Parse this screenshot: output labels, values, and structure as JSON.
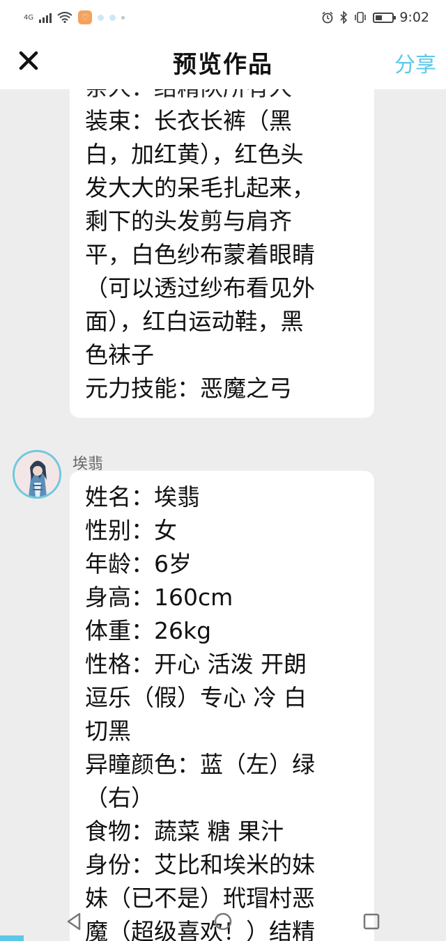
{
  "status_bar": {
    "network": "4G",
    "time": "9:02",
    "icons": [
      "signal-icon",
      "wifi-icon",
      "app-notification-icon",
      "alarm-icon",
      "bluetooth-icon",
      "vibrate-icon",
      "battery-icon"
    ]
  },
  "navbar": {
    "close_icon": "close-icon",
    "title": "预览作品",
    "share_label": "分享"
  },
  "post1": {
    "lines": [
      "亲人：结精队所有人",
      "装束：长衣长裤（黑",
      "白，加红黄），红色头",
      "发大大的呆毛扎起来，",
      "剩下的头发剪与肩齐",
      "平，白色纱布蒙着眼睛",
      "（可以透过纱布看见外",
      "面），红白运动鞋，黑",
      "色袜子",
      "元力技能：恶魔之弓"
    ]
  },
  "post2": {
    "author": "埃翡",
    "lines": [
      "姓名：埃翡",
      "性别：女",
      "年龄：6岁",
      "身高：160cm",
      "体重：26kg",
      "性格：开心 活泼 开朗",
      "逗乐（假）专心 冷 白",
      "切黑",
      "异瞳颜色：蓝（左）绿",
      "（右）",
      "食物：蔬菜 糖 果汁",
      "身份：艾比和埃米的妹",
      "妹（已不是）玳瑁村恶",
      "魔（超级喜欢！）结精"
    ]
  },
  "system_nav": [
    "back-icon",
    "home-icon",
    "recents-icon"
  ],
  "colors": {
    "accent": "#5cc8e8",
    "background": "#ededed"
  }
}
